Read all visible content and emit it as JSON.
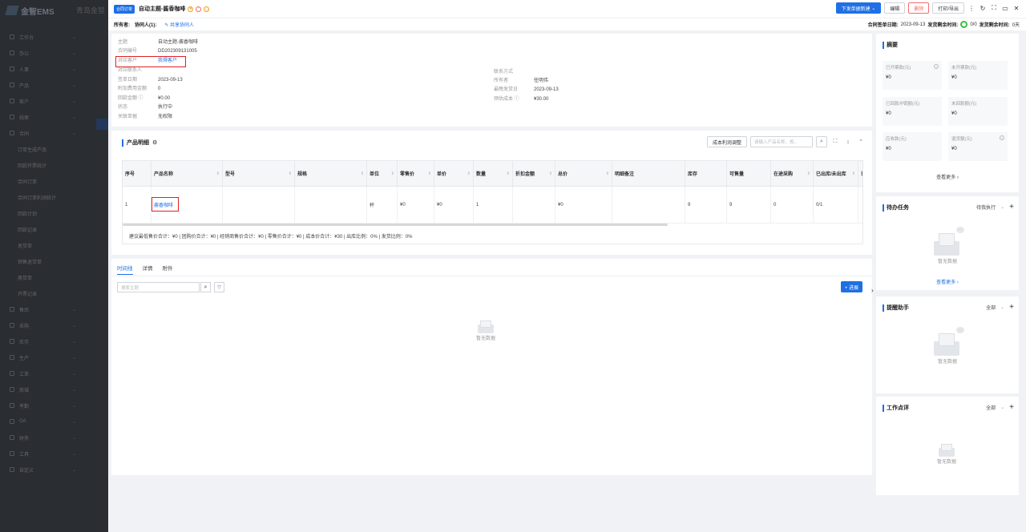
{
  "background": {
    "logo_text": "金智EMS",
    "topbar_text": "青岛金智",
    "menu": [
      {
        "label": "工作台",
        "sub": false
      },
      {
        "label": "办公",
        "sub": false
      },
      {
        "label": "人事",
        "sub": false
      },
      {
        "label": "产品",
        "sub": false
      },
      {
        "label": "客户",
        "sub": false
      },
      {
        "label": "线索",
        "sub": false
      },
      {
        "label": "合同",
        "sub": false
      },
      {
        "label": "订单生成产品",
        "sub": true
      },
      {
        "label": "回款开票统计",
        "sub": true
      },
      {
        "label": "合同订单",
        "sub": true
      },
      {
        "label": "合同订单利润统计",
        "sub": true
      },
      {
        "label": "回款计划",
        "sub": true
      },
      {
        "label": "回款记录",
        "sub": true
      },
      {
        "label": "发货单",
        "sub": true
      },
      {
        "label": "销售退货单",
        "sub": true
      },
      {
        "label": "换货单",
        "sub": true
      },
      {
        "label": "开票记录",
        "sub": true
      },
      {
        "label": "售后",
        "sub": false
      },
      {
        "label": "采购",
        "sub": false
      },
      {
        "label": "库存",
        "sub": false
      },
      {
        "label": "生产",
        "sub": false
      },
      {
        "label": "工单",
        "sub": false
      },
      {
        "label": "商城",
        "sub": false
      },
      {
        "label": "考勤",
        "sub": false
      },
      {
        "label": "OA",
        "sub": false
      },
      {
        "label": "财务",
        "sub": false
      },
      {
        "label": "工具",
        "sub": false
      },
      {
        "label": "自定义",
        "sub": false
      }
    ]
  },
  "header": {
    "tag": "合同订单",
    "title": "自动主题-酱香咖啡",
    "buttons": {
      "new_order": "下发单据新建",
      "edit": "编辑",
      "delete": "删除",
      "print": "打印/导出"
    },
    "window_icons": [
      "more-icon",
      "refresh-icon",
      "expand-icon",
      "minimize-icon",
      "close-icon"
    ]
  },
  "subheader": {
    "owner_label": "所有者:",
    "collab_label": "协同人(1):",
    "share_label": "共享协同人",
    "sign_date_label": "合同签单日期:",
    "sign_date": "2023-09-13",
    "delivery_remaining_label": "发货剩余时间:",
    "progress_text": "0/0",
    "delivery_remaining_label2": "发货剩余时间:",
    "delivery_days": "0天"
  },
  "info": {
    "left": [
      {
        "label": "主题",
        "value": "自动主题-酱香咖啡",
        "link": false
      },
      {
        "label": "合同编号",
        "value": "DD202309131005",
        "link": false
      },
      {
        "label": "对应客户",
        "value": "我得客户",
        "link": true
      },
      {
        "label": "对应联系人",
        "value": "",
        "link": false
      },
      {
        "label": "签单日期",
        "value": "2023-09-13",
        "link": false
      },
      {
        "label": "附加费用金额",
        "value": "0",
        "link": false
      },
      {
        "label": "回款金额 ⓘ",
        "value": "¥0.00",
        "link": false
      },
      {
        "label": "状态",
        "value": "执行中",
        "link": false
      },
      {
        "label": "关联单据",
        "value": "无权限",
        "link": false
      }
    ],
    "right": [
      {
        "label": "联系方式",
        "value": ""
      },
      {
        "label": "所有者",
        "value": "任明伟"
      },
      {
        "label": "最晚发货日",
        "value": "2023-09-13"
      },
      {
        "label": "预估成本 ⓘ",
        "value": "¥30.00"
      }
    ]
  },
  "products": {
    "title": "产品明细",
    "adjust_button": "成本利润调整",
    "search_placeholder": "请输入产品名称、规...",
    "columns": [
      "序号",
      "产品名称",
      "型号",
      "规格",
      "单位",
      "零售价",
      "单价",
      "数量",
      "折扣金额",
      "总价",
      "明细备注",
      "库存",
      "可售量",
      "在途采购",
      "已出库/未出库",
      "已"
    ],
    "rows": [
      [
        "1",
        "酱香咖啡",
        "",
        "",
        "杯",
        "¥0",
        "¥0",
        "1",
        "",
        "¥0",
        "",
        "9",
        "9",
        "0",
        "0/1",
        ""
      ]
    ],
    "summary": "建议最低售价合计：¥0 |  团购价合计：¥0 |  经销商售价合计：¥0 |  零售价合计：¥0 |  成本价合计：¥30 |  出库比例：0% |  发货比例：0%"
  },
  "timeline": {
    "tabs": [
      "时间线",
      "详情",
      "附件"
    ],
    "active_tab": 0,
    "search_placeholder": "搜索主题",
    "add_button": "+ 进展",
    "empty_text": "暂无数据"
  },
  "side": {
    "summary": {
      "title": "摘要",
      "metrics": [
        {
          "label": "已开票款(元)",
          "value": "¥0",
          "help": true
        },
        {
          "label": "未开票款(元)",
          "value": "¥0",
          "help": false
        },
        {
          "label": "已回款冲销额(元)",
          "value": "¥0",
          "help": false
        },
        {
          "label": "未回款额(元)",
          "value": "¥0",
          "help": false
        },
        {
          "label": "应收款(元)",
          "value": "¥0",
          "help": false
        },
        {
          "label": "退货额(元)",
          "value": "¥0",
          "help": true
        }
      ],
      "more": "查看更多"
    },
    "todo": {
      "title": "待办任务",
      "filter": "待我执行",
      "empty": "暂无数据",
      "more": "查看更多"
    },
    "reminder": {
      "title": "提醒助手",
      "filter": "全部",
      "empty": "暂无数据"
    },
    "review": {
      "title": "工作点评",
      "filter": "全部",
      "empty": "暂无数据"
    }
  }
}
